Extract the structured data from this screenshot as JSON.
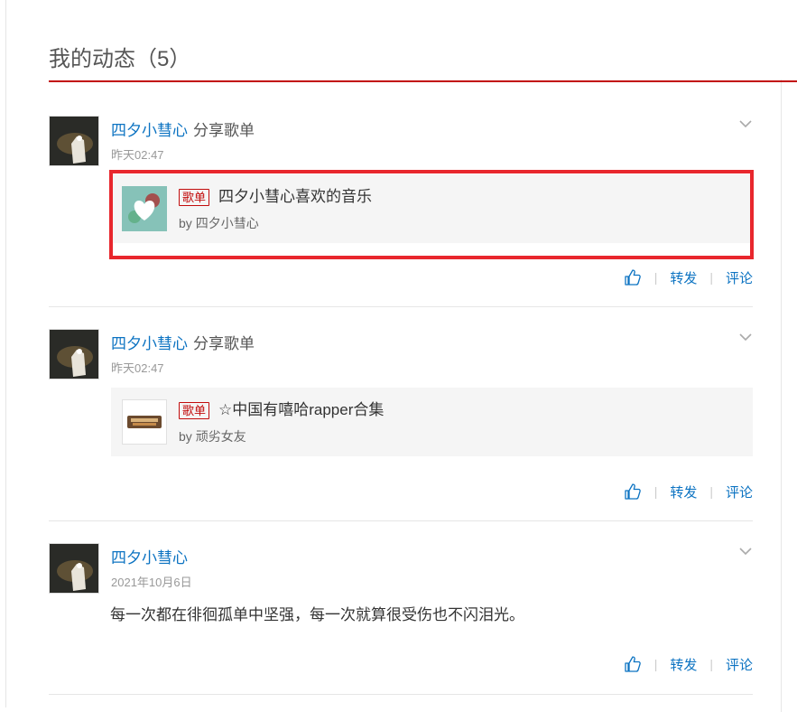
{
  "header": {
    "title": "我的动态（5）"
  },
  "feed": [
    {
      "user": "四夕小彗心",
      "action": "分享歌单",
      "time": "昨天02:47",
      "card": {
        "tag": "歌单",
        "title": "四夕小彗心喜欢的音乐",
        "by_label": "by",
        "by_name": "四夕小彗心"
      },
      "ops": {
        "forward": "转发",
        "comment": "评论"
      }
    },
    {
      "user": "四夕小彗心",
      "action": "分享歌单",
      "time": "昨天02:47",
      "card": {
        "tag": "歌单",
        "title": "☆中国有嘻哈rapper合集",
        "by_label": "by",
        "by_name": "顽劣女友"
      },
      "ops": {
        "forward": "转发",
        "comment": "评论"
      }
    },
    {
      "user": "四夕小彗心",
      "time": "2021年10月6日",
      "text": "每一次都在徘徊孤单中坚强，每一次就算很受伤也不闪泪光。",
      "ops": {
        "forward": "转发",
        "comment": "评论"
      }
    }
  ],
  "colors": {
    "accent": "#c20c0c",
    "link": "#0c73c2",
    "highlight": "#e8272d"
  },
  "icons": [
    "chevron-down-icon",
    "thumbs-up-icon"
  ]
}
